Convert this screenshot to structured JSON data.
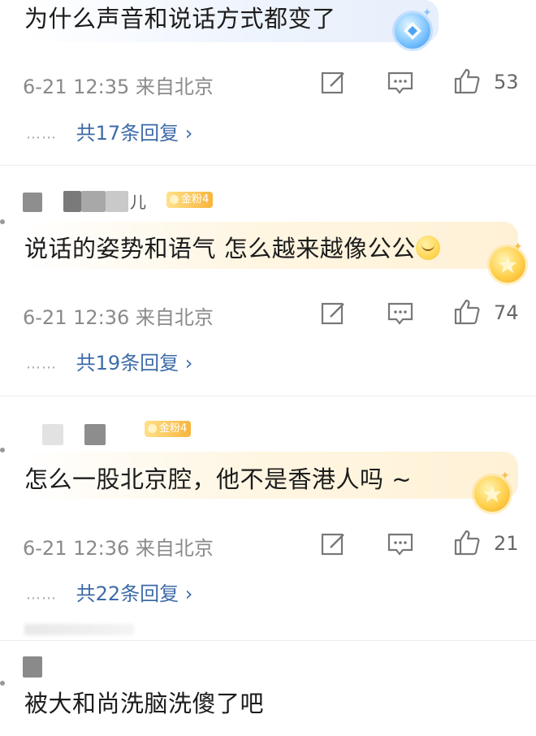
{
  "comments": [
    {
      "text": "为什么声音和说话方式都变了",
      "meta": "6-21 12:35 来自北京",
      "likes": "53",
      "replies": "共17条回复 ›",
      "dots": "……"
    },
    {
      "username": "儿",
      "fan_badge": "金粉4",
      "text": "说话的姿势和语气 怎么越来越像公公",
      "meta": "6-21 12:36 来自北京",
      "likes": "74",
      "replies": "共19条回复 ›",
      "dots": "……"
    },
    {
      "fan_badge": "金粉4",
      "text": "怎么一股北京腔，他不是香港人吗 ~",
      "meta": "6-21 12:36 来自北京",
      "likes": "21",
      "replies": "共22条回复 ›",
      "dots": "……"
    },
    {
      "text": "被大和尚洗脑洗傻了吧"
    }
  ],
  "icons": {
    "repost": "edit-square-icon",
    "comment": "comment-bubble-icon",
    "like": "thumbs-up-icon",
    "badge_star": "star-badge-icon",
    "badge_diamond": "diamond-badge-icon",
    "emoji": "drooling-face-emoji"
  },
  "colors": {
    "reply_link": "#3d6ba8",
    "meta_text": "#8a8a8a",
    "gold_bubble": "#fff1d6",
    "blue_bubble": "#e7effb"
  }
}
